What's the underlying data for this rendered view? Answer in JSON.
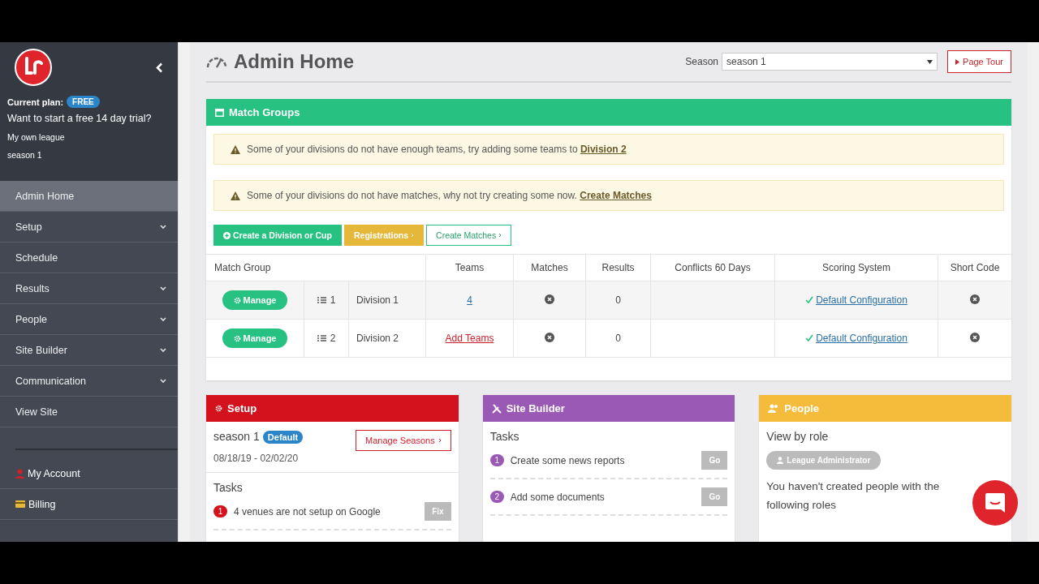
{
  "sidebar": {
    "plan_label": "Current plan:",
    "plan_badge": "FREE",
    "trial_text": "Want to start a free 14 day trial?",
    "league": "My own league",
    "season": "season 1",
    "nav": [
      {
        "label": "Admin Home",
        "selected": true,
        "expandable": false
      },
      {
        "label": "Setup",
        "selected": false,
        "expandable": true
      },
      {
        "label": "Schedule",
        "selected": false,
        "expandable": false
      },
      {
        "label": "Results",
        "selected": false,
        "expandable": true
      },
      {
        "label": "People",
        "selected": false,
        "expandable": true
      },
      {
        "label": "Site Builder",
        "selected": false,
        "expandable": true
      },
      {
        "label": "Communication",
        "selected": false,
        "expandable": true
      },
      {
        "label": "View Site",
        "selected": false,
        "expandable": false
      }
    ],
    "account": [
      {
        "label": "My Account",
        "kind": "account"
      },
      {
        "label": "Billing",
        "kind": "billing"
      }
    ]
  },
  "header": {
    "title": "Admin Home",
    "season_label": "Season",
    "season_value": "season 1",
    "tour_button": "Page Tour"
  },
  "match_groups": {
    "title": "Match Groups",
    "alerts": [
      {
        "text": "Some of your divisions do not have enough teams, try adding some teams to",
        "link": "Division 2"
      },
      {
        "text": "Some of your divisions do not have matches, why not try creating some now.",
        "link": "Create Matches"
      }
    ],
    "buttons": [
      {
        "label": "Create a Division or Cup",
        "kind": "primary"
      },
      {
        "label": "Registrations",
        "kind": "warning"
      },
      {
        "label": "Create Matches",
        "kind": "outline"
      }
    ],
    "table": {
      "columns": [
        "Match Group",
        "Teams",
        "Matches",
        "Results",
        "Conflicts 60 Days",
        "Scoring System",
        "Short Code"
      ],
      "rows": [
        {
          "manage": "Manage",
          "order": "1",
          "name": "Division 1",
          "teams": {
            "text": "4",
            "kind": "count"
          },
          "results": "0",
          "scoring": "Default Configuration"
        },
        {
          "manage": "Manage",
          "order": "2",
          "name": "Division 2",
          "teams": {
            "text": "Add Teams",
            "kind": "add"
          },
          "results": "0",
          "scoring": "Default Configuration"
        }
      ]
    }
  },
  "setup": {
    "title": "Setup",
    "season": "season 1",
    "badge": "Default",
    "manage_button": "Manage Seasons",
    "dates": "08/18/19 - 02/02/20",
    "tasks_title": "Tasks",
    "tasks": [
      {
        "number": "1",
        "text": "4 venues are not setup on Google",
        "button": "Fix"
      }
    ]
  },
  "site_builder": {
    "title": "Site Builder",
    "tasks_title": "Tasks",
    "tasks": [
      {
        "number": "1",
        "text": "Create some news reports",
        "button": "Go"
      },
      {
        "number": "2",
        "text": "Add some documents",
        "button": "Go"
      }
    ]
  },
  "people": {
    "title": "People",
    "subtitle": "View by role",
    "role": "League Administrator",
    "note": "You haven't created people with the following roles"
  }
}
